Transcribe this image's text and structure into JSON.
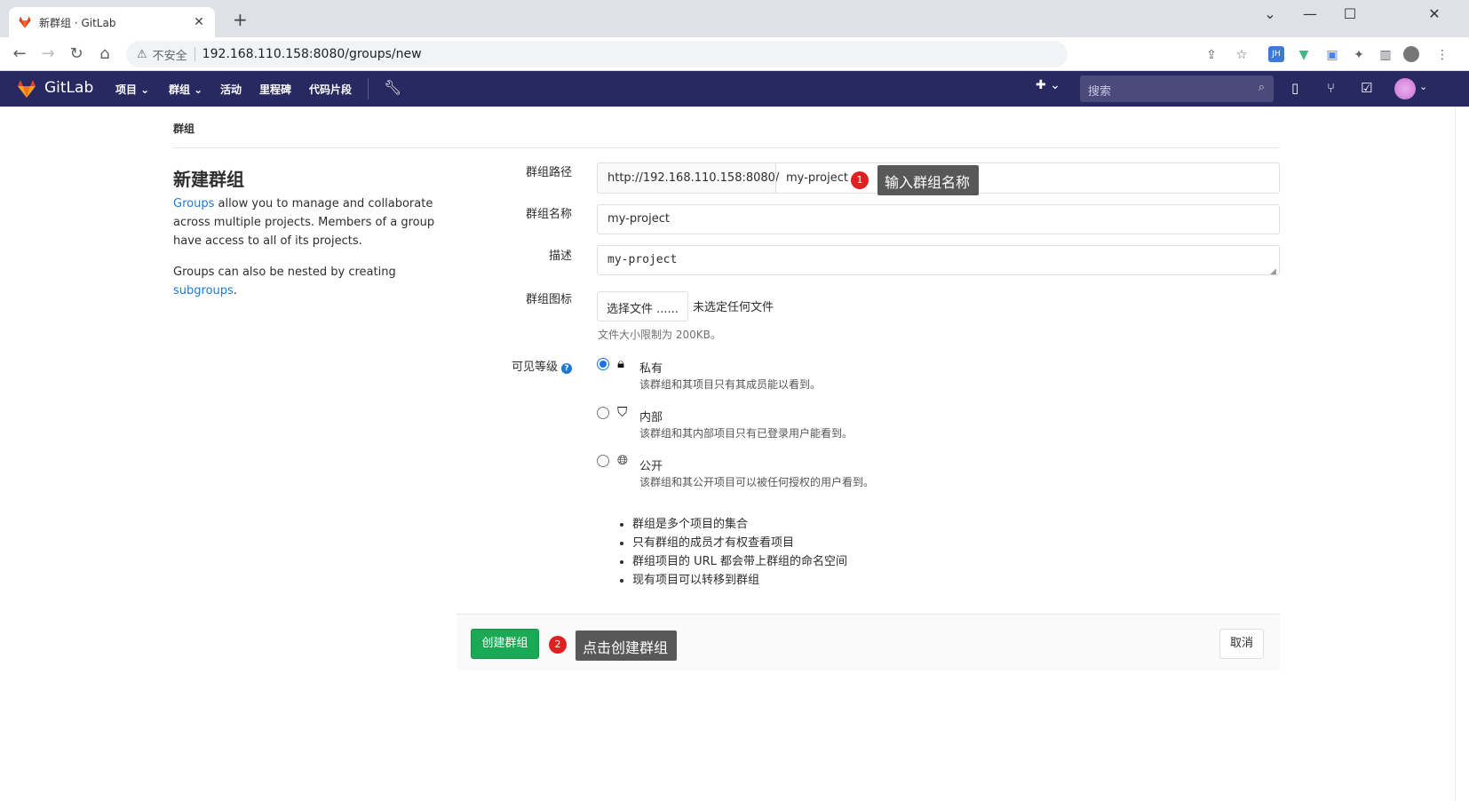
{
  "browser": {
    "tab_title": "新群组 · GitLab",
    "tab_close": "✕",
    "new_tab": "+",
    "insecure_label": "不安全",
    "url": "192.168.110.158:8080/groups/new",
    "window_controls": [
      "⌄",
      "—",
      "☐",
      "✕"
    ]
  },
  "gitlab_nav": {
    "brand": "GitLab",
    "menu": [
      "项目 ⌄",
      "群组 ⌄",
      "活动",
      "里程碑",
      "代码片段"
    ],
    "search_placeholder": "搜索",
    "plus_label": "✚ ⌄"
  },
  "breadcrumb": "群组",
  "left": {
    "title": "新建群组",
    "p1_link": "Groups",
    "p1_rest": " allow you to manage and collaborate across multiple projects. Members of a group have access to all of its projects.",
    "p2_text": "Groups can also be nested by creating ",
    "p2_link": "subgroups",
    "p2_end": "."
  },
  "form": {
    "path_label": "群组路径",
    "path_prefix": "http://192.168.110.158:8080/",
    "path_value": "my-project",
    "name_label": "群组名称",
    "name_value": "my-project",
    "desc_label": "描述",
    "desc_value": "my-project",
    "avatar_label": "群组图标",
    "file_button": "选择文件 ......",
    "file_none": "未选定任何文件",
    "file_hint": "文件大小限制为 200KB。",
    "visibility_label": "可见等级",
    "visibility": [
      {
        "title": "私有",
        "desc": "该群组和其项目只有其成员能以看到。",
        "checked": true,
        "icon": "lock-icon"
      },
      {
        "title": "内部",
        "desc": "该群组和其内部项目只有已登录用户能看到。",
        "checked": false,
        "icon": "shield-icon"
      },
      {
        "title": "公开",
        "desc": "该群组和其公开项目可以被任何授权的用户看到。",
        "checked": false,
        "icon": "globe-icon"
      }
    ],
    "bullets": [
      "群组是多个项目的集合",
      "只有群组的成员才有权查看项目",
      "群组项目的 URL 都会带上群组的命名空间",
      "现有项目可以转移到群组"
    ],
    "create_button": "创建群组",
    "cancel_button": "取消"
  },
  "annotations": {
    "badge1": "1",
    "callout1": "输入群组名称",
    "badge2": "2",
    "callout2": "点击创建群组"
  },
  "colors": {
    "gitlab_nav_bg": "#292961",
    "create_button_bg": "#1aaa55",
    "link": "#1f78d1",
    "badge": "#e02020",
    "callout_bg": "#585858"
  }
}
